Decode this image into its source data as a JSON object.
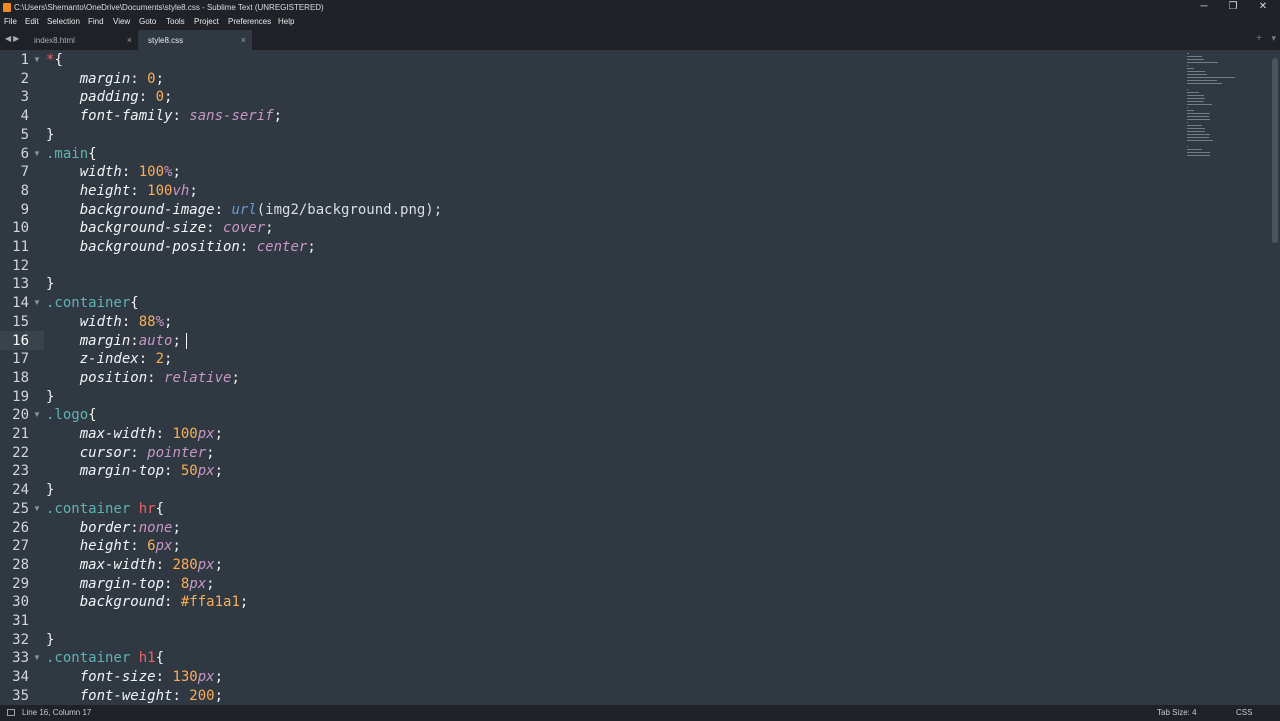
{
  "window": {
    "title": "C:\\Users\\Shemanto\\OneDrive\\Documents\\style8.css - Sublime Text (UNREGISTERED)",
    "minimize": "─",
    "restore": "❐",
    "close": "✕"
  },
  "menu": [
    "File",
    "Edit",
    "Selection",
    "Find",
    "View",
    "Goto",
    "Tools",
    "Project",
    "Preferences",
    "Help"
  ],
  "tabs": [
    {
      "label": "index8.html",
      "close": "×",
      "active": false
    },
    {
      "label": "style8.css",
      "close": "×",
      "active": true
    }
  ],
  "editor": {
    "cursor_line": 16,
    "line_numbers": [
      "1",
      "2",
      "3",
      "4",
      "5",
      "6",
      "7",
      "8",
      "9",
      "10",
      "11",
      "12",
      "13",
      "14",
      "15",
      "16",
      "17",
      "18",
      "19",
      "20",
      "21",
      "22",
      "23",
      "24",
      "25",
      "26",
      "27",
      "28",
      "29",
      "30",
      "31",
      "32",
      "33",
      "34",
      "35"
    ],
    "fold_arrow": "▼",
    "code": [
      [
        {
          "t": "*",
          "c": "tag"
        },
        {
          "t": "{",
          "c": "punc"
        }
      ],
      [
        {
          "t": "    margin",
          "c": "prop"
        },
        {
          "t": ": ",
          "c": "punc"
        },
        {
          "t": "0",
          "c": "num"
        },
        {
          "t": ";",
          "c": "punc"
        }
      ],
      [
        {
          "t": "    padding",
          "c": "prop"
        },
        {
          "t": ": ",
          "c": "punc"
        },
        {
          "t": "0",
          "c": "num"
        },
        {
          "t": ";",
          "c": "punc"
        }
      ],
      [
        {
          "t": "    font-family",
          "c": "prop"
        },
        {
          "t": ": ",
          "c": "punc"
        },
        {
          "t": "sans-serif",
          "c": "kw"
        },
        {
          "t": ";",
          "c": "punc"
        }
      ],
      [
        {
          "t": "}",
          "c": "punc"
        }
      ],
      [
        {
          "t": ".main",
          "c": "sel"
        },
        {
          "t": "{",
          "c": "punc"
        }
      ],
      [
        {
          "t": "    width",
          "c": "prop"
        },
        {
          "t": ": ",
          "c": "punc"
        },
        {
          "t": "100",
          "c": "num"
        },
        {
          "t": "%",
          "c": "unit"
        },
        {
          "t": ";",
          "c": "punc"
        }
      ],
      [
        {
          "t": "    height",
          "c": "prop"
        },
        {
          "t": ": ",
          "c": "punc"
        },
        {
          "t": "100",
          "c": "num"
        },
        {
          "t": "vh",
          "c": "unit"
        },
        {
          "t": ";",
          "c": "punc"
        }
      ],
      [
        {
          "t": "    background-image",
          "c": "prop"
        },
        {
          "t": ": ",
          "c": "punc"
        },
        {
          "t": "url",
          "c": "fn"
        },
        {
          "t": "(img2/background.png);",
          "c": "plain"
        }
      ],
      [
        {
          "t": "    background-size",
          "c": "prop"
        },
        {
          "t": ": ",
          "c": "punc"
        },
        {
          "t": "cover",
          "c": "kw"
        },
        {
          "t": ";",
          "c": "punc"
        }
      ],
      [
        {
          "t": "    background-position",
          "c": "prop"
        },
        {
          "t": ": ",
          "c": "punc"
        },
        {
          "t": "center",
          "c": "kw"
        },
        {
          "t": ";",
          "c": "punc"
        }
      ],
      [],
      [
        {
          "t": "}",
          "c": "punc"
        }
      ],
      [
        {
          "t": ".container",
          "c": "sel"
        },
        {
          "t": "{",
          "c": "punc"
        }
      ],
      [
        {
          "t": "    width",
          "c": "prop"
        },
        {
          "t": ": ",
          "c": "punc"
        },
        {
          "t": "88",
          "c": "num"
        },
        {
          "t": "%",
          "c": "unit"
        },
        {
          "t": ";",
          "c": "punc"
        }
      ],
      [
        {
          "t": "    margin",
          "c": "prop"
        },
        {
          "t": ":",
          "c": "punc"
        },
        {
          "t": "auto",
          "c": "kw"
        },
        {
          "t": ";",
          "c": "punc"
        }
      ],
      [
        {
          "t": "    z-index",
          "c": "prop"
        },
        {
          "t": ": ",
          "c": "punc"
        },
        {
          "t": "2",
          "c": "num"
        },
        {
          "t": ";",
          "c": "punc"
        }
      ],
      [
        {
          "t": "    position",
          "c": "prop"
        },
        {
          "t": ": ",
          "c": "punc"
        },
        {
          "t": "relative",
          "c": "kw"
        },
        {
          "t": ";",
          "c": "punc"
        }
      ],
      [
        {
          "t": "}",
          "c": "punc"
        }
      ],
      [
        {
          "t": ".logo",
          "c": "sel"
        },
        {
          "t": "{",
          "c": "punc"
        }
      ],
      [
        {
          "t": "    max-width",
          "c": "prop"
        },
        {
          "t": ": ",
          "c": "punc"
        },
        {
          "t": "100",
          "c": "num"
        },
        {
          "t": "px",
          "c": "unit"
        },
        {
          "t": ";",
          "c": "punc"
        }
      ],
      [
        {
          "t": "    cursor",
          "c": "prop"
        },
        {
          "t": ": ",
          "c": "punc"
        },
        {
          "t": "pointer",
          "c": "kw"
        },
        {
          "t": ";",
          "c": "punc"
        }
      ],
      [
        {
          "t": "    margin-top",
          "c": "prop"
        },
        {
          "t": ": ",
          "c": "punc"
        },
        {
          "t": "50",
          "c": "num"
        },
        {
          "t": "px",
          "c": "unit"
        },
        {
          "t": ";",
          "c": "punc"
        }
      ],
      [
        {
          "t": "}",
          "c": "punc"
        }
      ],
      [
        {
          "t": ".container",
          "c": "sel"
        },
        {
          "t": " ",
          "c": "plain"
        },
        {
          "t": "hr",
          "c": "tag"
        },
        {
          "t": "{",
          "c": "punc"
        }
      ],
      [
        {
          "t": "    border",
          "c": "prop"
        },
        {
          "t": ":",
          "c": "punc"
        },
        {
          "t": "none",
          "c": "kw"
        },
        {
          "t": ";",
          "c": "punc"
        }
      ],
      [
        {
          "t": "    height",
          "c": "prop"
        },
        {
          "t": ": ",
          "c": "punc"
        },
        {
          "t": "6",
          "c": "num"
        },
        {
          "t": "px",
          "c": "unit"
        },
        {
          "t": ";",
          "c": "punc"
        }
      ],
      [
        {
          "t": "    max-width",
          "c": "prop"
        },
        {
          "t": ": ",
          "c": "punc"
        },
        {
          "t": "280",
          "c": "num"
        },
        {
          "t": "px",
          "c": "unit"
        },
        {
          "t": ";",
          "c": "punc"
        }
      ],
      [
        {
          "t": "    margin-top",
          "c": "prop"
        },
        {
          "t": ": ",
          "c": "punc"
        },
        {
          "t": "8",
          "c": "num"
        },
        {
          "t": "px",
          "c": "unit"
        },
        {
          "t": ";",
          "c": "punc"
        }
      ],
      [
        {
          "t": "    background",
          "c": "prop"
        },
        {
          "t": ": ",
          "c": "punc"
        },
        {
          "t": "#ffa1a1",
          "c": "hash"
        },
        {
          "t": ";",
          "c": "punc"
        }
      ],
      [],
      [
        {
          "t": "}",
          "c": "punc"
        }
      ],
      [
        {
          "t": ".container",
          "c": "sel"
        },
        {
          "t": " ",
          "c": "plain"
        },
        {
          "t": "h1",
          "c": "tag"
        },
        {
          "t": "{",
          "c": "punc"
        }
      ],
      [
        {
          "t": "    font-size",
          "c": "prop"
        },
        {
          "t": ": ",
          "c": "punc"
        },
        {
          "t": "130",
          "c": "num"
        },
        {
          "t": "px",
          "c": "unit"
        },
        {
          "t": ";",
          "c": "punc"
        }
      ],
      [
        {
          "t": "    font-weight",
          "c": "prop"
        },
        {
          "t": ": ",
          "c": "punc"
        },
        {
          "t": "200",
          "c": "num"
        },
        {
          "t": ";",
          "c": "punc"
        }
      ]
    ],
    "folded_lines": [
      1,
      6,
      14,
      20,
      25,
      33
    ]
  },
  "status": {
    "position": "Line 16, Column 17",
    "tab_size": "Tab Size: 4",
    "syntax": "CSS"
  },
  "colors": {
    "background": "#303841",
    "selector": "#5fb3b3",
    "tag": "#ec5f67",
    "number": "#f9ae58",
    "keyword": "#c798c7",
    "function": "#6699cc"
  }
}
